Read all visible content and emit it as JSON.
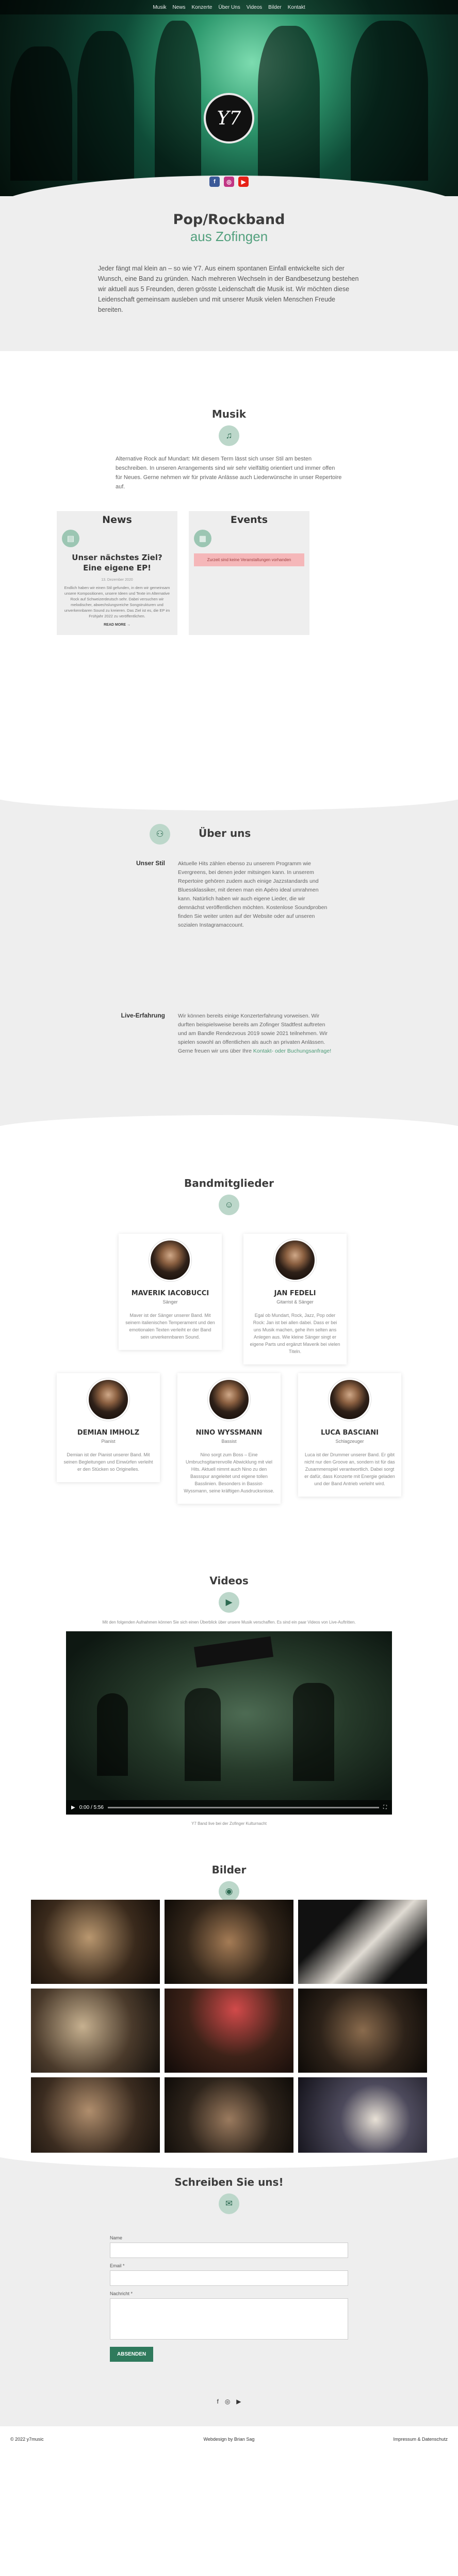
{
  "nav": [
    "Musik",
    "News",
    "Konzerte",
    "Über Uns",
    "Videos",
    "Bilder",
    "Kontakt"
  ],
  "hero": {
    "logo": "Y7",
    "social": [
      "f",
      "◎",
      "▶"
    ],
    "colors": {
      "facebook": "#3b5998",
      "instagram": "#c13584",
      "youtube": "#e62117"
    }
  },
  "intro": {
    "title": "Pop/Rockband",
    "subtitle": "aus Zofingen",
    "text": "Jeder fängt mal klein an – so wie Y7. Aus einem spontanen Einfall entwickelte sich der Wunsch, eine Band zu gründen. Nach mehreren Wechseln in der Bandbesetzung bestehen wir aktuell aus 5 Freunden, deren grösste Leidenschaft die Musik ist. Wir möchten diese Leidenschaft gemeinsam ausleben und mit unserer Musik vielen Menschen Freude bereiten."
  },
  "musik": {
    "title": "Musik",
    "icon": "music-note-icon",
    "text": "Alternative Rock auf Mundart: Mit diesem Term lässt sich unser Stil am besten beschreiben. In unseren Arrangements sind wir sehr vielfältig orientiert und immer offen für Neues. Gerne nehmen wir für private Anlässe auch Liederwünsche in unser Repertoire auf."
  },
  "news": {
    "title": "News",
    "post_title": "Unser nächstes Ziel? Eine eigene EP!",
    "date": "13. Dezember 2020",
    "body": "Endlich haben wir einen Stil gefunden, in dem wir gemeinsam unsere Kompositionen, unsere Ideen und Texte im Alternative Rock auf Schweizerdeutsch sehr. Dabei versuchen wir melodischer, abwechslungsreiche Songstrukturen und unverkennbaren Sound zu kreieren. Das Ziel ist es, die EP im Frühjahr 2022 zu veröffentlichen.",
    "more": "READ MORE →"
  },
  "events": {
    "title": "Events",
    "empty": "Zurzeit sind keine Veranstaltungen vorhanden"
  },
  "about": {
    "title": "Über uns",
    "rows": [
      {
        "label": "Unser Stil",
        "text": "Aktuelle Hits zählen ebenso zu unserem Programm wie Evergreens, bei denen jeder mitsingen kann. In unserem Repertoire gehören zudem auch einige Jazzstandards und Bluessklassiker, mit denen man ein Apéro ideal umrahmen kann. Natürlich haben wir auch eigene Lieder, die wir demnächst veröffentlichen möchten. Kostenlose Soundproben finden Sie weiter unten auf der Website oder auf unseren sozialen Instagramaccount."
      },
      {
        "label": "Live-Erfahrung",
        "text": "Wir können bereits einige Konzerterfahrung vorweisen. Wir durften beispielsweise bereits am Zofinger Stadtfest auftreten und am Bandle Rendezvous 2019 sowie 2021 teilnehmen. Wir spielen sowohl an öffentlichen als auch an privaten Anlässen. Gerne freuen wir uns über Ihre ",
        "link": "Kontakt- oder Buchungsanfrage!"
      }
    ]
  },
  "members": {
    "title": "Bandmitglieder",
    "list": [
      {
        "name": "MAVERIK IACOBUCCI",
        "role": "Sänger",
        "desc": "Maver ist der Sänger unserer Band. Mit seinem italienischen Temperament und den emotionalen Texten verleiht er der Band sein unverkennbaren Sound."
      },
      {
        "name": "JAN FEDELI",
        "role": "Gitarrist & Sänger",
        "desc": "Egal ob Mundart, Rock, Jazz, Pop oder Rock: Jan ist bei allen dabei. Dass er bei uns Musik machen, gehe ihm selten ans Anlegen aus. Wie kleine Sänger singt er eigene Parts und ergänzt Maverik bei vielen Titeln."
      },
      {
        "name": "DEMIAN IMHOLZ",
        "role": "Pianist",
        "desc": "Demian ist der Pianist unserer Band. Mit seinen Begleitungen und Einwürfen verleiht er den Stücken so Originelles."
      },
      {
        "name": "NINO WYSSMANN",
        "role": "Bassist",
        "desc": "Nino sorgt zum Boss – Eine Umbruchsgitarrenvolle Abwicklung mit viel Hits. Aktuell nimmt auch Nino zu den Bassspur angeleitet und eigene tollen Basslinien. Besonders in Bassist-Wyssmann, seine kräftigen Ausdrucksnisse."
      },
      {
        "name": "LUCA BASCIANI",
        "role": "Schlagzeuger",
        "desc": "Luca ist der Drummer unserer Band. Er gibt nicht nur den Groove an, sondern ist für das Zusammenspiel verantwortlich. Dabei sorgt er dafür, dass Konzerte mit Energie geladen und der Band Antrieb verleiht wird."
      }
    ]
  },
  "videos": {
    "title": "Videos",
    "caption": "Mit den folgenden Aufnahmen können Sie sich einen Überblick über unsere Musik verschaffen. Es sind ein paar Videos von Live-Auftritten.",
    "time": "0:00 / 5:56",
    "subcaption": "Y7 Band live bei der Zofinger Kulturnacht"
  },
  "bilder": {
    "title": "Bilder",
    "count": 9
  },
  "contact": {
    "title": "Schreiben Sie uns!",
    "name_label": "Name",
    "email_label": "Email *",
    "msg_label": "Nachricht *",
    "send": "ABSENDEN",
    "social": [
      "f",
      "◎",
      "▶"
    ]
  },
  "footer": {
    "left": "© 2022 y7music",
    "center": "Webdesign by Brian Sag",
    "right": "Impressum & Datenschutz"
  }
}
